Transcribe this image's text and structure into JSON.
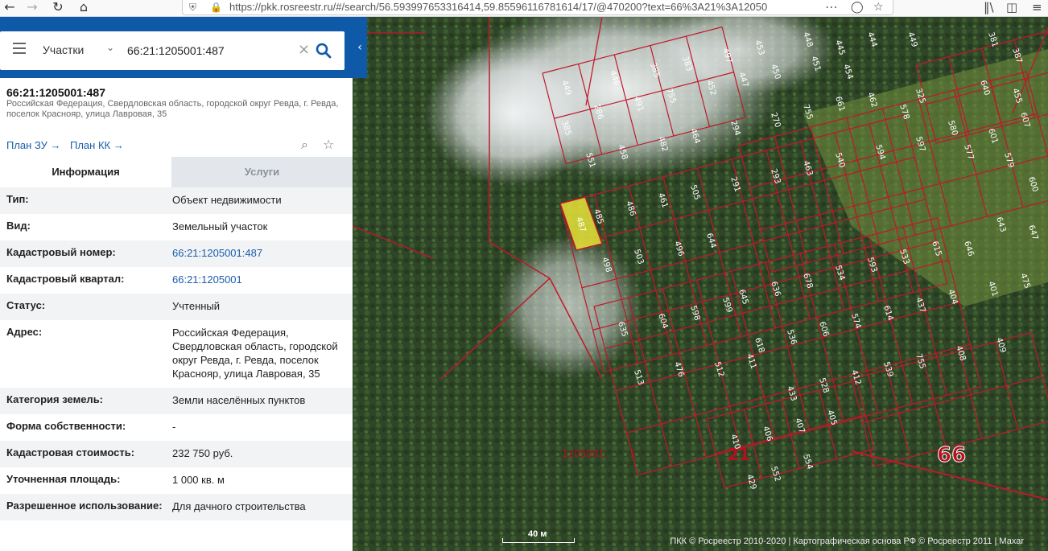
{
  "browser": {
    "url": "https://pkk.rosreestr.ru/#/search/56.593997653316414,59.85596116781614/17/@470200?text=66%3A21%3A12050",
    "url_host": "pkk.rosreestr.ru"
  },
  "search": {
    "type_label": "Участки",
    "query": "66:21:1205001:487"
  },
  "parcel": {
    "number": "66:21:1205001:487",
    "address": "Российская Федерация, Свердловская область, городской округ Ревда, г. Ревда, поселок Краснояр, улица Лавровая, 35",
    "plan_zu": "План ЗУ",
    "plan_kk": "План КК"
  },
  "tabs": {
    "info": "Информация",
    "services": "Услуги"
  },
  "rows": [
    {
      "key": "Тип:",
      "value": "Объект недвижимости",
      "link": false
    },
    {
      "key": "Вид:",
      "value": "Земельный участок",
      "link": false
    },
    {
      "key": "Кадастровый номер:",
      "value": "66:21:1205001:487",
      "link": true
    },
    {
      "key": "Кадастровый квартал:",
      "value": "66:21:1205001",
      "link": true
    },
    {
      "key": "Статус:",
      "value": "Учтенный",
      "link": false
    },
    {
      "key": "Адрес:",
      "value": "Российская Федерация, Свердловская область, городской округ Ревда, г. Ревда, поселок Краснояр, улица Лавровая, 35",
      "link": false
    },
    {
      "key": "Категория земель:",
      "value": "Земли населённых пунктов",
      "link": false
    },
    {
      "key": "Форма собственности:",
      "value": "-",
      "link": false
    },
    {
      "key": "Кадастровая стоимость:",
      "value": "232 750 руб.",
      "link": false
    },
    {
      "key": "Уточненная площадь:",
      "value": "1 000 кв. м",
      "link": false
    },
    {
      "key": "Разрешенное использование:",
      "value": "Для дачного строительства",
      "link": false
    }
  ],
  "map": {
    "scale_label": "40 м",
    "footer": "ПКК © Росреестр 2010-2020 | Картографическая основа РФ © Росреестр 2011 | Махаr",
    "quarter_label": "1205001",
    "district_label": "21",
    "region_label": "66",
    "selected_parcel": "487",
    "parcel_labels": [
      "449",
      "446",
      "385",
      "383",
      "497",
      "453",
      "448",
      "445",
      "444",
      "449",
      "381",
      "387",
      "385",
      "286",
      "491",
      "755",
      "452",
      "447",
      "450",
      "451",
      "454",
      "325",
      "640",
      "455",
      "551",
      "458",
      "482",
      "464",
      "294",
      "270",
      "755",
      "661",
      "462",
      "578",
      "580",
      "601",
      "607",
      "485",
      "486",
      "461",
      "505",
      "291",
      "293",
      "463",
      "540",
      "594",
      "597",
      "577",
      "579",
      "600",
      "498",
      "503",
      "496",
      "644",
      "645",
      "636",
      "678",
      "534",
      "593",
      "533",
      "615",
      "646",
      "643",
      "647",
      "635",
      "604",
      "598",
      "599",
      "618",
      "536",
      "606",
      "574",
      "614",
      "437",
      "404",
      "401",
      "475",
      "513",
      "476",
      "512",
      "411",
      "433",
      "528",
      "412",
      "539",
      "755",
      "408",
      "409",
      "410",
      "406",
      "407",
      "405",
      "429",
      "552",
      "554",
      "2",
      "755",
      "1"
    ],
    "colors": {
      "boundary": "#c0182a",
      "selected_fill": "#e8e43a",
      "label_red": "#b80f1f"
    }
  }
}
